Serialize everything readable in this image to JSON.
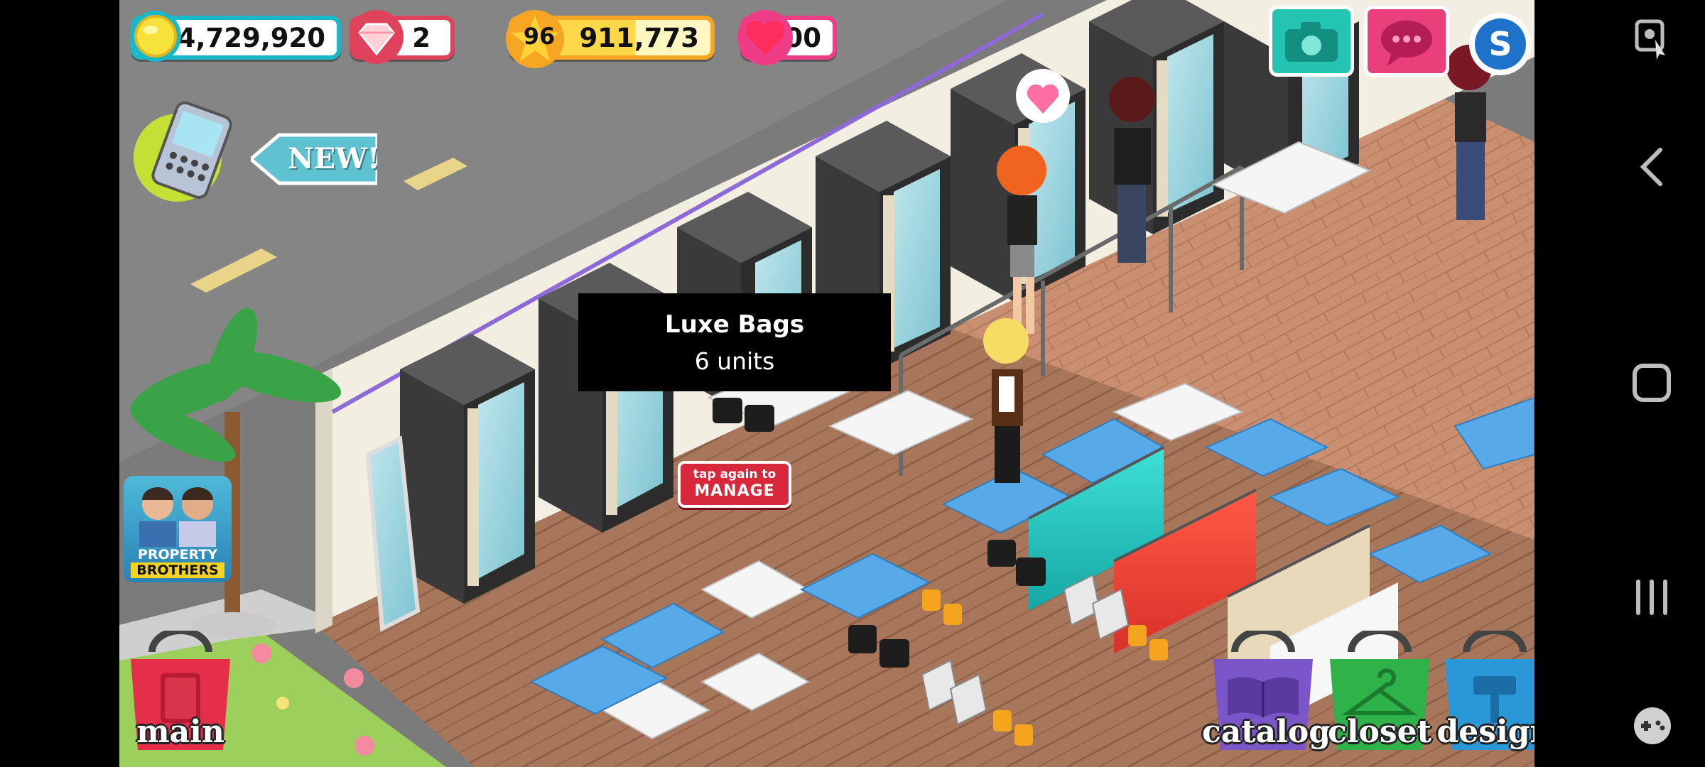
{
  "hud": {
    "coins": "14,729,920",
    "gems": "2",
    "level": "96",
    "xp": "911,773",
    "hearts": "100"
  },
  "badges": {
    "new": "NEW!"
  },
  "tooltip": {
    "title": "Luxe Bags",
    "subtitle": "6 units"
  },
  "tap_sign": {
    "line1": "tap again to",
    "line2": "MANAGE"
  },
  "promo": {
    "line1": "PROPERTY",
    "line2": "BROTHERS"
  },
  "bottom_buttons": {
    "main": "main",
    "catalog": "catalog",
    "closet": "closet",
    "design": "design"
  },
  "icons": [
    "coin-icon",
    "gem-icon",
    "star-icon",
    "heart-icon",
    "phone-icon",
    "camera-icon",
    "chat-icon",
    "social-s-icon",
    "screenshot-icon",
    "back-icon",
    "home-icon",
    "recents-icon",
    "gamepad-icon"
  ],
  "colors": {
    "coin_border": "#19b8c9",
    "gem_border": "#e0415b",
    "xp_border": "#f6a623",
    "heart_border": "#ee3d86",
    "camera_btn": "#23c4b0",
    "chat_btn": "#e93f7a",
    "main_btn": "#e52f4a",
    "catalog_btn": "#7a56c8",
    "closet_btn": "#2fb24a",
    "design_btn": "#2a98d8"
  }
}
